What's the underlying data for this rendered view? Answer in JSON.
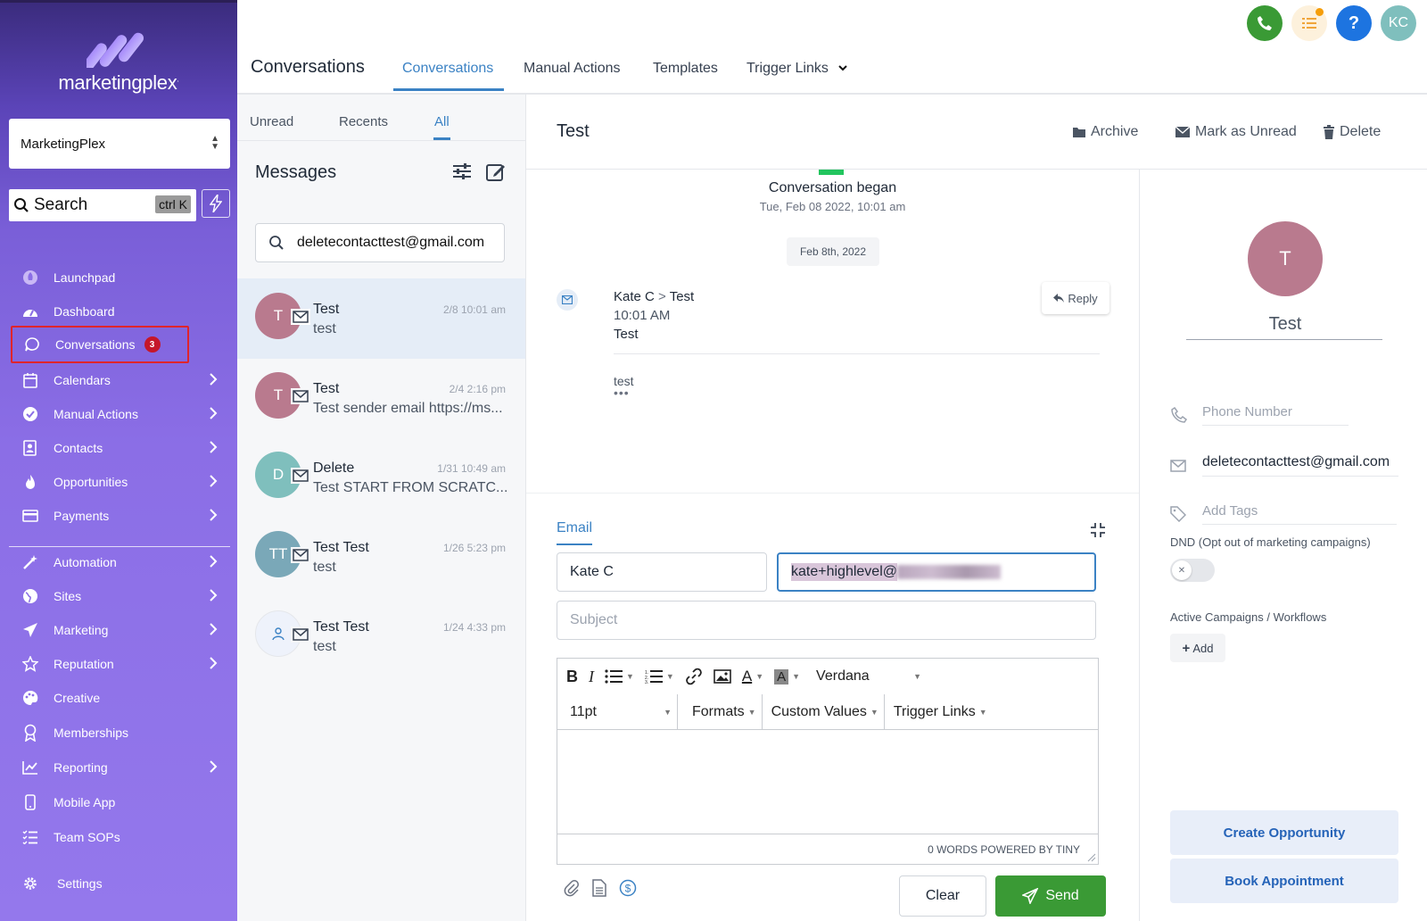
{
  "brand": {
    "name": "marketingplex",
    "tm": "."
  },
  "account": {
    "name": "MarketingPlex"
  },
  "sidebar_search": {
    "label": "Search",
    "shortcut": "ctrl K"
  },
  "nav": {
    "items": [
      {
        "label": "Launchpad",
        "icon": "rocket-icon"
      },
      {
        "label": "Dashboard",
        "icon": "speedometer-icon"
      },
      {
        "label": "Conversations",
        "icon": "chat-bubble-icon",
        "badge": "3"
      },
      {
        "label": "Calendars",
        "icon": "calendar-icon"
      },
      {
        "label": "Manual Actions",
        "icon": "check-circle-icon"
      },
      {
        "label": "Contacts",
        "icon": "contact-card-icon"
      },
      {
        "label": "Opportunities",
        "icon": "flame-icon"
      },
      {
        "label": "Payments",
        "icon": "credit-card-icon"
      },
      {
        "label": "Automation",
        "icon": "magic-wand-icon"
      },
      {
        "label": "Sites",
        "icon": "globe-icon"
      },
      {
        "label": "Marketing",
        "icon": "paper-plane-icon"
      },
      {
        "label": "Reputation",
        "icon": "star-icon"
      },
      {
        "label": "Creative",
        "icon": "palette-icon"
      },
      {
        "label": "Memberships",
        "icon": "award-icon"
      },
      {
        "label": "Reporting",
        "icon": "chart-icon"
      },
      {
        "label": "Mobile App",
        "icon": "phone-icon"
      },
      {
        "label": "Team SOPs",
        "icon": "list-icon"
      }
    ],
    "settings": "Settings"
  },
  "header": {
    "title": "Conversations",
    "tabs": [
      "Conversations",
      "Manual Actions",
      "Templates",
      "Trigger Links"
    ],
    "user_initials": "KC",
    "help": "?"
  },
  "list": {
    "filter_tabs": [
      "Unread",
      "Recents",
      "All"
    ],
    "title": "Messages",
    "search_value": "deletecontacttest@gmail.com",
    "conversations": [
      {
        "initials": "T",
        "name": "Test",
        "time": "2/8 10:01 am",
        "snippet": "test",
        "color": "#b97a8e"
      },
      {
        "initials": "T",
        "name": "Test",
        "time": "2/4 2:16 pm",
        "snippet": "Test sender email https://ms...",
        "color": "#b97a8e"
      },
      {
        "initials": "D",
        "name": "Delete",
        "time": "1/31 10:49 am",
        "snippet": "Test START FROM SCRATC...",
        "color": "#7fbfbd"
      },
      {
        "initials": "TT",
        "name": "Test Test",
        "time": "1/26 5:23 pm",
        "snippet": "test",
        "color": "#7aa8b8"
      },
      {
        "initials": "",
        "name": "Test Test",
        "time": "1/24 4:33 pm",
        "snippet": "test",
        "color": "#eef2fb"
      }
    ]
  },
  "thread": {
    "title": "Test",
    "actions": {
      "archive": "Archive",
      "mark_unread": "Mark as Unread",
      "delete": "Delete"
    },
    "began": "Conversation began",
    "began_date": "Tue, Feb 08 2022, 10:01 am",
    "date_chip": "Feb 8th, 2022",
    "message": {
      "from": "Kate C",
      "separator": ">",
      "to": "Test",
      "time": "10:01 AM",
      "subject": "Test",
      "body": "test",
      "more": "•••"
    },
    "reply": "Reply"
  },
  "composer": {
    "tab": "Email",
    "from_name": "Kate C",
    "from_email_visible": "kate+highlevel@",
    "subject_placeholder": "Subject",
    "toolbar": {
      "font": "Verdana",
      "size": "11pt",
      "formats": "Formats",
      "custom_values": "Custom Values",
      "trigger_links": "Trigger Links"
    },
    "footer": "0 WORDS POWERED BY TINY",
    "clear": "Clear",
    "send": "Send"
  },
  "contact": {
    "initial": "T",
    "name": "Test",
    "phone_placeholder": "Phone Number",
    "email": "deletecontacttest@gmail.com",
    "tags_placeholder": "Add Tags",
    "dnd_label": "DND (Opt out of marketing campaigns)",
    "campaigns_label": "Active Campaigns / Workflows",
    "add": "Add",
    "create_opportunity": "Create Opportunity",
    "book_appointment": "Book Appointment"
  },
  "colors": {
    "accent": "#3b82c4",
    "send_green": "#3a9a35",
    "badge_red": "#c5172a",
    "phone_green": "#3a9a35",
    "help_blue": "#1d74e0",
    "avatar_teal": "#7fbfbd"
  }
}
